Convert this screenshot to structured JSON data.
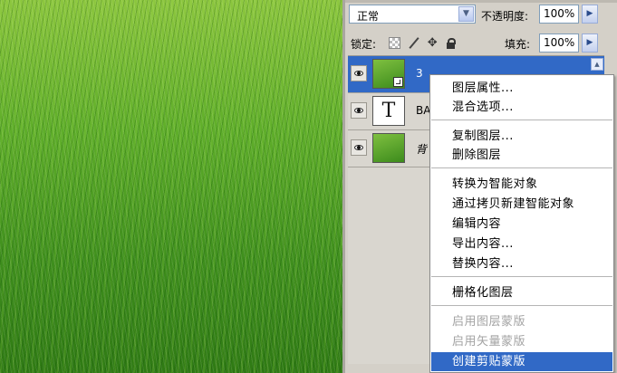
{
  "panel": {
    "blend_mode": "正常",
    "opacity_label": "不透明度:",
    "opacity_value": "100%",
    "lock_label": "锁定:",
    "fill_label": "填充:",
    "fill_value": "100%"
  },
  "layers": [
    {
      "name": "3",
      "thumb": "grass",
      "selected": true
    },
    {
      "name": "BA",
      "thumb": "T",
      "selected": false
    },
    {
      "name": "背",
      "thumb": "grass",
      "selected": false
    }
  ],
  "icons": {
    "visibility": "eye-icon",
    "lock_transparent": "checkerboard-icon",
    "lock_paint": "brush-icon",
    "lock_move": "move-icon",
    "lock_all": "lock-icon",
    "dropdown": "chevron-down-icon",
    "flyout": "triangle-right-icon",
    "smart_object": "smart-object-badge-icon"
  },
  "context_menu": {
    "items": [
      {
        "label": "图层属性...",
        "state": "normal"
      },
      {
        "label": "混合选项...",
        "state": "normal"
      },
      {
        "label": "复制图层...",
        "state": "normal"
      },
      {
        "label": "删除图层",
        "state": "normal"
      },
      {
        "label": "转换为智能对象",
        "state": "normal"
      },
      {
        "label": "通过拷贝新建智能对象",
        "state": "normal"
      },
      {
        "label": "编辑内容",
        "state": "normal"
      },
      {
        "label": "导出内容...",
        "state": "normal"
      },
      {
        "label": "替换内容...",
        "state": "normal"
      },
      {
        "label": "栅格化图层",
        "state": "normal"
      },
      {
        "label": "启用图层蒙版",
        "state": "disabled"
      },
      {
        "label": "启用矢量蒙版",
        "state": "disabled"
      },
      {
        "label": "创建剪贴蒙版",
        "state": "highlighted"
      }
    ]
  },
  "colors": {
    "selection": "#3169c6",
    "panel_bg": "#d4d0c8",
    "disabled_text": "#a3a3a3"
  }
}
